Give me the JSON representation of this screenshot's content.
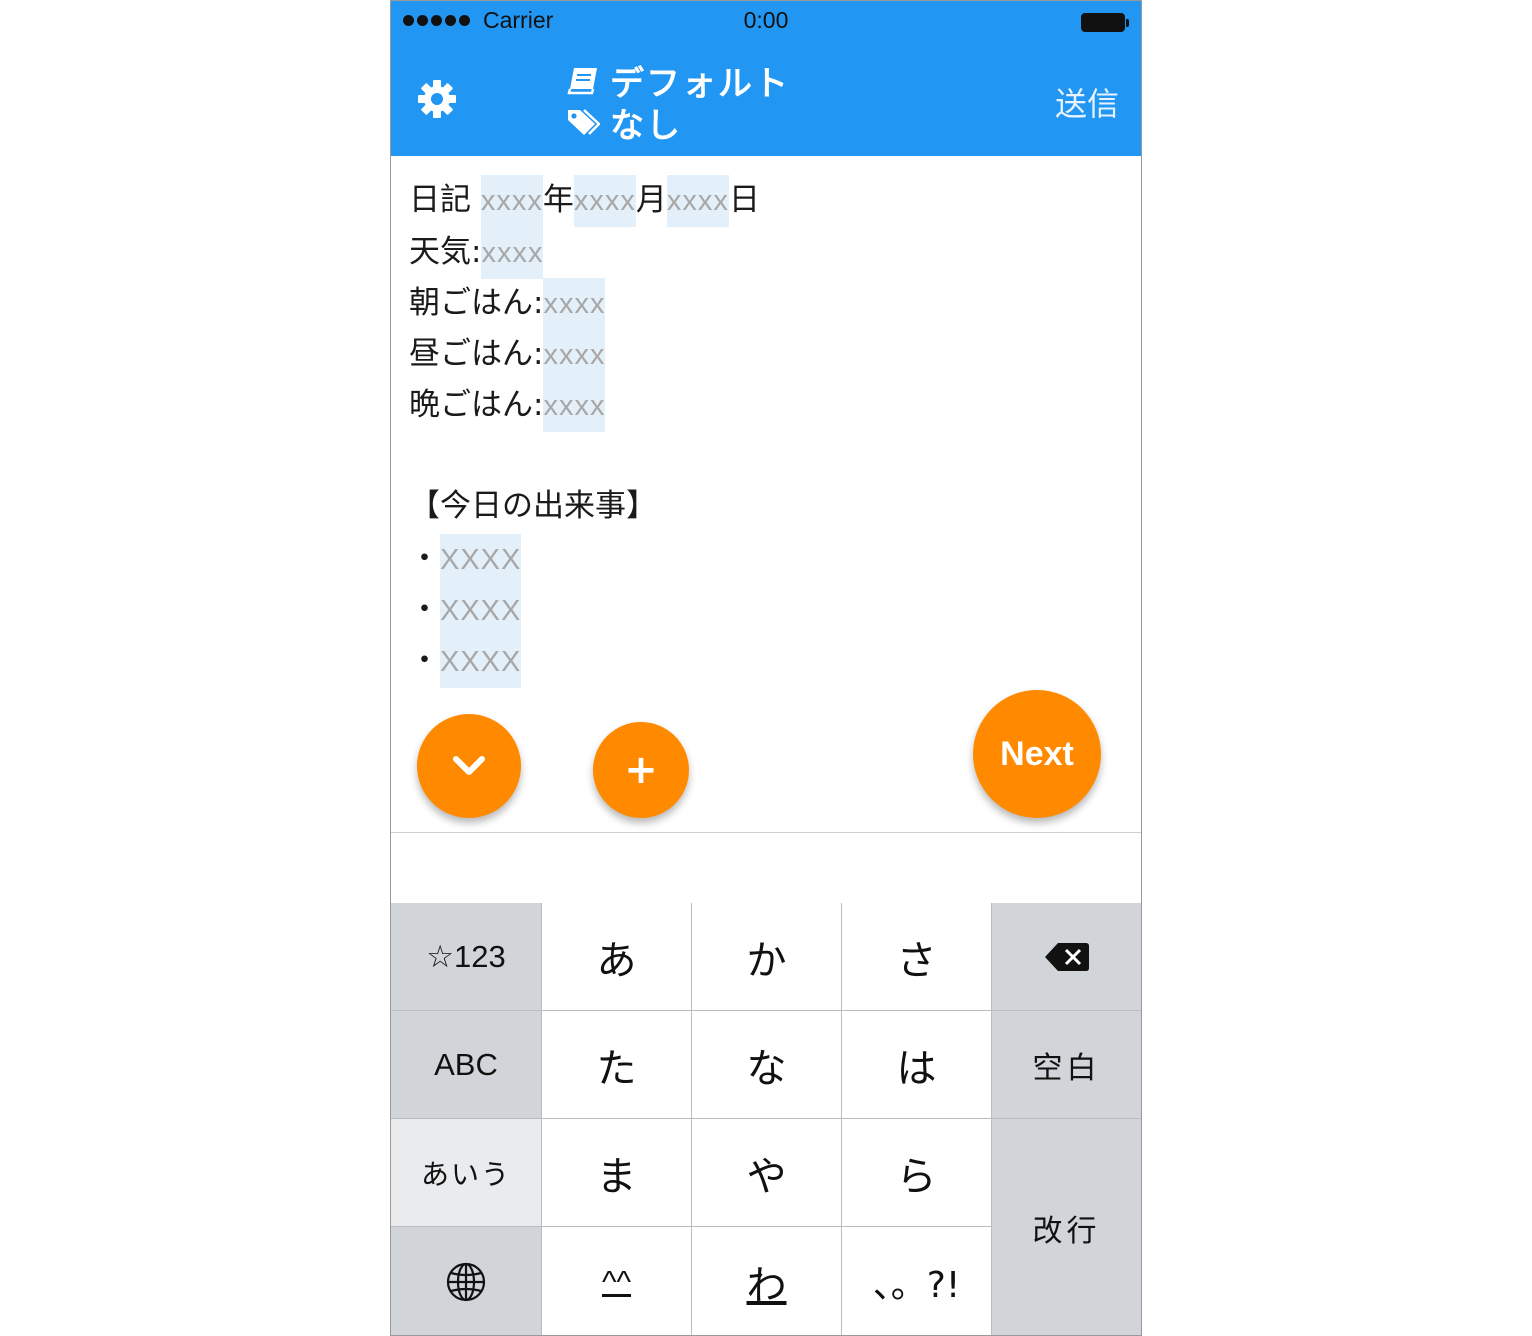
{
  "status_bar": {
    "carrier": "Carrier",
    "time": "0:00"
  },
  "nav": {
    "title": "デフォルト",
    "tag": "なし",
    "send": "送信"
  },
  "editor": {
    "lines": [
      {
        "label": "日記 "
      },
      {
        "label": "天気:"
      },
      {
        "label": "朝ごはん:"
      },
      {
        "label": "昼ごはん:"
      },
      {
        "label": "晩ごはん:"
      },
      {
        "label": "【今日の出来事】"
      },
      {
        "label": "・"
      }
    ],
    "date_parts": [
      "年",
      "月",
      "日"
    ],
    "placeholder": "xxxx",
    "bullet_placeholder": "XXXX"
  },
  "buttons": {
    "next": "Next",
    "plus": "+"
  },
  "keyboard": {
    "row1": [
      "☆123",
      "あ",
      "か",
      "さ"
    ],
    "row2": [
      "ABC",
      "た",
      "な",
      "は",
      "空白"
    ],
    "row3": [
      "あいう",
      "ま",
      "や",
      "ら"
    ],
    "row4": [
      "^^",
      "わ",
      "、。?!"
    ],
    "enter": "改行"
  },
  "colors": {
    "nav": "#2196f3",
    "fab": "#ff8a00",
    "placeholder_bg": "#e3f0fa"
  }
}
